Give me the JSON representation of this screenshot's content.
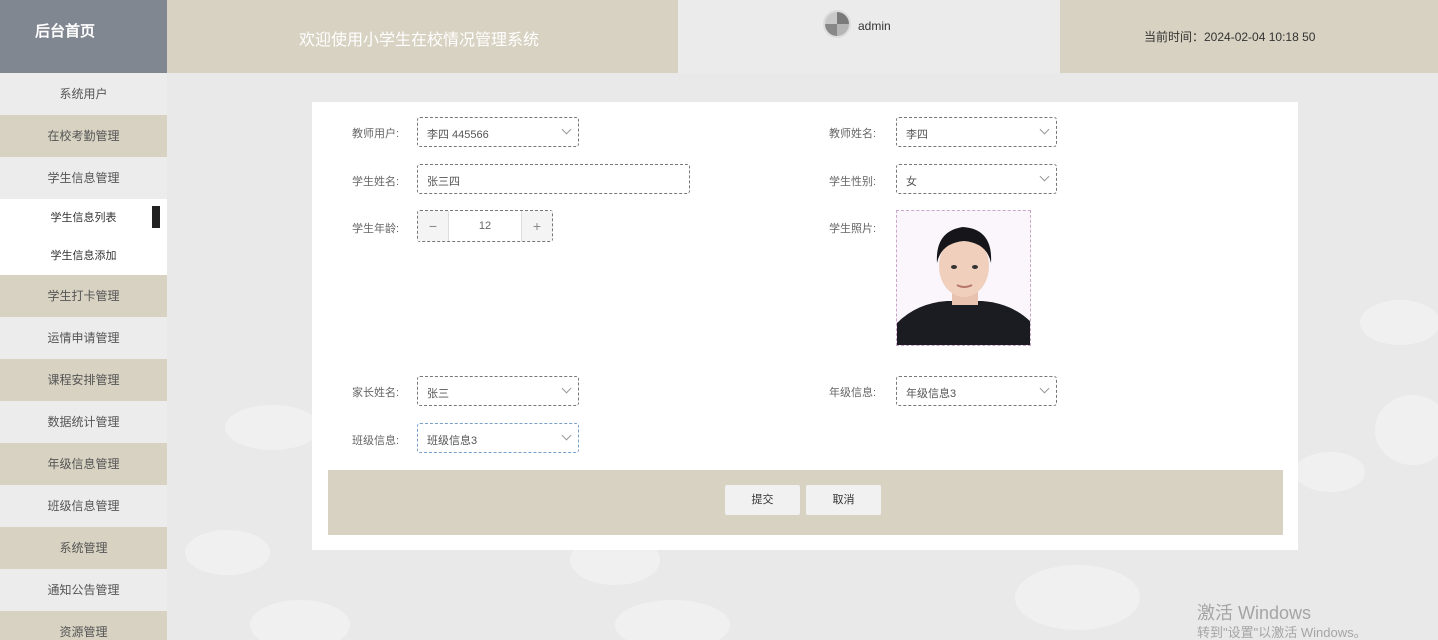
{
  "header": {
    "home": "后台首页",
    "title": "欢迎使用小学生在校情况管理系统",
    "username": "admin",
    "time": "当前时间：2024-02-04 10:18 50"
  },
  "sidebar": {
    "items": [
      {
        "label": "系统用户"
      },
      {
        "label": "在校考勤管理"
      },
      {
        "label": "学生信息管理"
      },
      {
        "label": "学生信息列表"
      },
      {
        "label": "学生信息添加"
      },
      {
        "label": "学生打卡管理"
      },
      {
        "label": "运情申请管理"
      },
      {
        "label": "课程安排管理"
      },
      {
        "label": "数据统计管理"
      },
      {
        "label": "年级信息管理"
      },
      {
        "label": "班级信息管理"
      },
      {
        "label": "系统管理"
      },
      {
        "label": "通知公告管理"
      },
      {
        "label": "资源管理"
      }
    ]
  },
  "form": {
    "teacher_user": {
      "label": "教师用户:",
      "value": "李四 445566"
    },
    "teacher_name": {
      "label": "教师姓名:",
      "value": "李四"
    },
    "student_name": {
      "label": "学生姓名:",
      "value": "张三四"
    },
    "student_gender": {
      "label": "学生性别:",
      "value": "女"
    },
    "student_age": {
      "label": "学生年龄:",
      "value": "12",
      "minus": "−",
      "plus": "+"
    },
    "student_photo": {
      "label": "学生照片:"
    },
    "parent_name": {
      "label": "家长姓名:",
      "value": "张三"
    },
    "grade_info": {
      "label": "年级信息:",
      "value": "年级信息3"
    },
    "class_info": {
      "label": "班级信息:",
      "value": "班级信息3"
    },
    "submit_label": "提交",
    "cancel_label": "取消"
  },
  "watermark": {
    "line1": "激活 Windows",
    "line2": "转到\"设置\"以激活 Windows。"
  }
}
